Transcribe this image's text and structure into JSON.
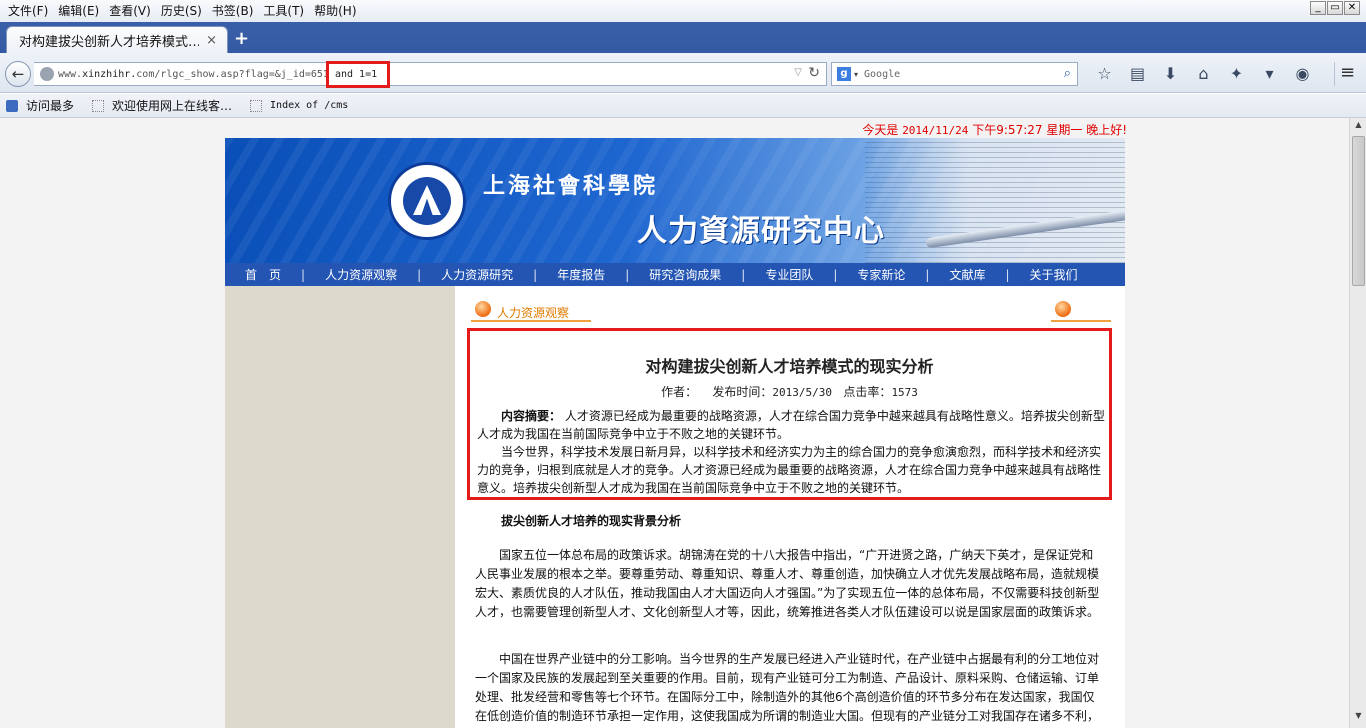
{
  "browser": {
    "menu": [
      "文件(F)",
      "编辑(E)",
      "查看(V)",
      "历史(S)",
      "书签(B)",
      "工具(T)",
      "帮助(H)"
    ],
    "window_controls": [
      "_",
      "▭",
      "✕"
    ],
    "tab_title": "对构建拔尖创新人才培养模式…",
    "tab_close": "×",
    "new_tab": "+",
    "url_prefix": "www.",
    "url_domain": "xinzhihr.",
    "url_rest": "com/rlgc_show.asp?flag=&j_id=651",
    "url_injected": "and 1=1",
    "search_placeholder": "Google",
    "bookmarks": [
      "访问最多",
      "欢迎使用网上在线客…",
      "Index of /cms"
    ]
  },
  "page": {
    "datebar": {
      "label": "今天是",
      "date": "2014/11/24",
      "time": "下午9:57:27",
      "weekday": "星期一",
      "greeting": "晚上好!"
    },
    "banner": {
      "title_small": "上海社會科學院",
      "title_large": "人力資源研究中心"
    },
    "nav": [
      "首　页",
      "人力资源观察",
      "人力资源研究",
      "年度报告",
      "研究咨询成果",
      "专业团队",
      "专家新论",
      "文献库",
      "关于我们"
    ],
    "section_label": "人力资源观察",
    "article": {
      "title": "对构建拔尖创新人才培养模式的现实分析",
      "author_label": "作者：",
      "published_label": "发布时间：",
      "published_date": "2013/5/30",
      "clicks_label": "点击率：",
      "clicks": "1573",
      "abstract_label": "内容摘要：",
      "abstract": "人才资源已经成为最重要的战略资源，人才在综合国力竞争中越来越具有战略性意义。培养拔尖创新型人才成为我国在当前国际竞争中立于不败之地的关键环节。",
      "intro": "当今世界，科学技术发展日新月异，以科学技术和经济实力为主的综合国力的竞争愈演愈烈，而科学技术和经济实力的竞争，归根到底就是人才的竞争。人才资源已经成为最重要的战略资源，人才在综合国力竞争中越来越具有战略性意义。培养拔尖创新型人才成为我国在当前国际竞争中立于不败之地的关键环节。",
      "subheading": "拔尖创新人才培养的现实背景分析",
      "para1": "国家五位一体总布局的政策诉求。胡锦涛在党的十八大报告中指出，“广开进贤之路，广纳天下英才，是保证党和人民事业发展的根本之举。要尊重劳动、尊重知识、尊重人才、尊重创造，加快确立人才优先发展战略布局，造就规模宏大、素质优良的人才队伍，推动我国由人才大国迈向人才强国。”为了实现五位一体的总体布局，不仅需要科技创新型人才，也需要管理创新型人才、文化创新型人才等，因此，统筹推进各类人才队伍建设可以说是国家层面的政策诉求。",
      "para2": "中国在世界产业链中的分工影响。当今世界的生产发展已经进入产业链时代，在产业链中占据最有利的分工地位对一个国家及民族的发展起到至关重要的作用。目前，现有产业链可分工为制造、产品设计、原料采购、仓储运输、订单处理、批发经营和零售等七个环节。在国际分工中，除制造外的其他6个高创造价值的环节多分布在发达国家，我国仅在低创造价值的制造环节承担一定作用，这使我国成为所谓的制造业大国。但现有的产业链分工对我国存在诸多不利，要"
    }
  },
  "colors": {
    "nav_bg": "#2455b3",
    "highlight_red": "#e31b1b",
    "date_red": "#e00000",
    "section_orange": "#e07b00"
  }
}
